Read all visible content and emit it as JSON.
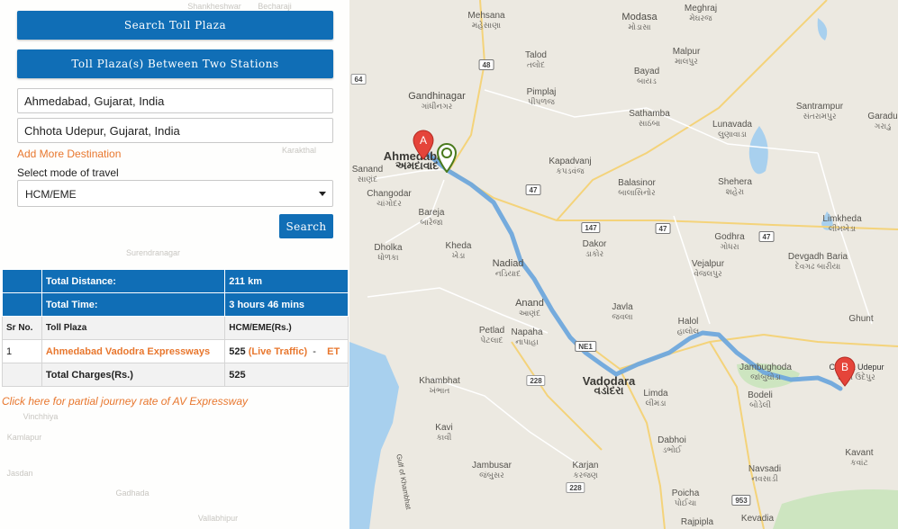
{
  "buttons": {
    "search_toll_plaza": "Search Toll Plaza",
    "between_stations": "Toll Plaza(s) Between Two Stations",
    "search": "Search"
  },
  "form": {
    "from_value": "Ahmedabad, Gujarat, India",
    "to_value": "Chhota Udepur, Gujarat, India",
    "add_more": "Add More Destination",
    "mode_label": "Select mode of travel",
    "mode_selected": "HCM/EME"
  },
  "results": {
    "total_distance_label": "Total Distance:",
    "total_distance_value": "211 km",
    "total_time_label": "Total Time:",
    "total_time_value": "3 hours 46 mins",
    "col_sr": "Sr No.",
    "col_plaza": "Toll Plaza",
    "col_rate": "HCM/EME(Rs.)",
    "rows": [
      {
        "sr": "1",
        "plaza": "Ahmedabad Vadodra Expressways",
        "amount": "525",
        "live": "(Live Traffic)",
        "sep": "-",
        "et": "ET"
      }
    ],
    "total_charges_label": "Total Charges(Rs.)",
    "total_charges_value": "525"
  },
  "partial_link": "Click here for partial journey rate of AV Expressway",
  "panel_background_labels": [
    "Shankheshwar",
    "Becharaji",
    "Karakthal",
    "Surendranagar",
    "Vinchhiya",
    "Kamlapur",
    "Jasdan",
    "Gadhada",
    "Vallabhipur"
  ],
  "map": {
    "places": [
      {
        "id": "ahmedabad",
        "name": "Ahmedabad",
        "sub": "અમદાવાદ"
      },
      {
        "id": "gandhinagar",
        "name": "Gandhinagar",
        "sub": "ગાંધીનગર"
      },
      {
        "id": "vadodara",
        "name": "Vadodara",
        "sub": "વડોદરા"
      },
      {
        "id": "chhota-udepur",
        "name": "Chhota Udepur",
        "sub": "છોટા ઉદેપુર"
      },
      {
        "id": "mehsana",
        "name": "Mehsana",
        "sub": "મહેસાણા"
      },
      {
        "id": "modasa",
        "name": "Modasa",
        "sub": "મોડાસા"
      },
      {
        "id": "meghraj",
        "name": "Meghraj",
        "sub": "મેઘરજ"
      },
      {
        "id": "talod",
        "name": "Talod",
        "sub": "તલોદ"
      },
      {
        "id": "malpur",
        "name": "Malpur",
        "sub": "માલપુર"
      },
      {
        "id": "bayad",
        "name": "Bayad",
        "sub": "બાયડ"
      },
      {
        "id": "pimplaj",
        "name": "Pimplaj",
        "sub": "પીપળજ"
      },
      {
        "id": "sathamba",
        "name": "Sathamba",
        "sub": "સાઠંબા"
      },
      {
        "id": "lunavada",
        "name": "Lunavada",
        "sub": "લુણાવાડા"
      },
      {
        "id": "santrampur",
        "name": "Santrampur",
        "sub": "સંતરામપુર"
      },
      {
        "id": "garadu",
        "name": "Garadu",
        "sub": "ગરાડુ"
      },
      {
        "id": "sanand",
        "name": "Sanand",
        "sub": "સાણંદ"
      },
      {
        "id": "changodar",
        "name": "Changodar",
        "sub": "ચાંગોદર"
      },
      {
        "id": "kapadvanj",
        "name": "Kapadvanj",
        "sub": "કપડવંજ"
      },
      {
        "id": "balasinor",
        "name": "Balasinor",
        "sub": "બાલાસિનોર"
      },
      {
        "id": "shehera",
        "name": "Shehera",
        "sub": "શહેરા"
      },
      {
        "id": "godhra",
        "name": "Godhra",
        "sub": "ગોધરા"
      },
      {
        "id": "limkheda",
        "name": "Limkheda",
        "sub": "લીમખેડા"
      },
      {
        "id": "bareja",
        "name": "Bareja",
        "sub": "બારેજા"
      },
      {
        "id": "dholka",
        "name": "Dholka",
        "sub": "ધોળકા"
      },
      {
        "id": "kheda",
        "name": "Kheda",
        "sub": "ખેડા"
      },
      {
        "id": "dakor",
        "name": "Dakor",
        "sub": "ડાકોર"
      },
      {
        "id": "vejalpur",
        "name": "Vejalpur",
        "sub": "વેજલપુર"
      },
      {
        "id": "devgadh-baria",
        "name": "Devgadh Baria",
        "sub": "દેવગઢ બારીયા"
      },
      {
        "id": "ghunt",
        "name": "Ghunt",
        "sub": ""
      },
      {
        "id": "nadiad",
        "name": "Nadiad",
        "sub": "નડિયાદ"
      },
      {
        "id": "anand",
        "name": "Anand",
        "sub": "આણંદ"
      },
      {
        "id": "javla",
        "name": "Javla",
        "sub": "જવલા"
      },
      {
        "id": "halol",
        "name": "Halol",
        "sub": "હાલોલ"
      },
      {
        "id": "petlad",
        "name": "Petlad",
        "sub": "પેટલાદ"
      },
      {
        "id": "napaha",
        "name": "Napaha",
        "sub": "નાપાહા"
      },
      {
        "id": "jambughoda",
        "name": "Jambughoda",
        "sub": "જાંબુઘોડા"
      },
      {
        "id": "bodeli",
        "name": "Bodeli",
        "sub": "બોડેલી"
      },
      {
        "id": "khambhat",
        "name": "Khambhat",
        "sub": "ખંભાત"
      },
      {
        "id": "limda",
        "name": "Limda",
        "sub": "લીમડા"
      },
      {
        "id": "kavi",
        "name": "Kavi",
        "sub": "કાવી"
      },
      {
        "id": "dabhoi",
        "name": "Dabhoi",
        "sub": "ડભોઈ"
      },
      {
        "id": "jambusar",
        "name": "Jambusar",
        "sub": "જંબુસર"
      },
      {
        "id": "karjan",
        "name": "Karjan",
        "sub": "કરજણ"
      },
      {
        "id": "navsadi",
        "name": "Navsadi",
        "sub": "નવસાડી"
      },
      {
        "id": "kavant",
        "name": "Kavant",
        "sub": "કવાંટ"
      },
      {
        "id": "poicha",
        "name": "Poicha",
        "sub": "પોઈચા"
      },
      {
        "id": "rajpipla",
        "name": "Rajpipla",
        "sub": ""
      },
      {
        "id": "kevadia",
        "name": "Kevadia",
        "sub": ""
      },
      {
        "id": "gulf",
        "name": "Gulf of Khambhat",
        "sub": ""
      }
    ],
    "shields": [
      "48",
      "47",
      "47",
      "47",
      "147",
      "NE1",
      "228",
      "228",
      "953",
      "64"
    ],
    "marker_a": "A",
    "marker_b": "B",
    "route_color": "#6fa8dc",
    "accent": "#106eb6",
    "link_color": "#e8772e"
  }
}
